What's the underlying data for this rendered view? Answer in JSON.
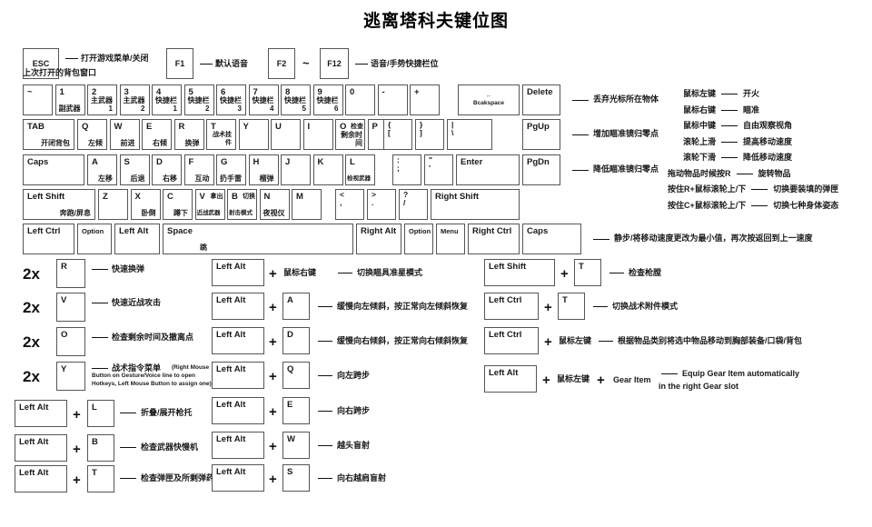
{
  "title": "逃离塔科夫键位图",
  "top_row": {
    "esc": {
      "label": "ESC",
      "desc_line1": "打开游戏菜单/关闭",
      "desc_line2": "上次打开的背包窗口"
    },
    "f1": {
      "label": "F1",
      "desc": "默认语音"
    },
    "f2": {
      "label": "F2"
    },
    "tilde_sep": "~",
    "f12": {
      "label": "F12",
      "desc": "语音/手势快捷栏位"
    }
  },
  "number_row": {
    "keys": [
      {
        "main": "~",
        "sub": ""
      },
      {
        "main": "1",
        "sub": "副武器"
      },
      {
        "main": "2",
        "sub": "主武器1"
      },
      {
        "main": "3",
        "sub": "主武器2"
      },
      {
        "main": "4",
        "sub": "快捷栏1"
      },
      {
        "main": "5",
        "sub": "快捷栏2"
      },
      {
        "main": "6",
        "sub": "快捷栏3"
      },
      {
        "main": "7",
        "sub": "快捷栏4"
      },
      {
        "main": "8",
        "sub": "快捷栏5"
      },
      {
        "main": "9",
        "sub": "快捷栏6"
      },
      {
        "main": "0",
        "sub": ""
      },
      {
        "main": "-",
        "sub": ""
      },
      {
        "main": "+",
        "sub": ""
      }
    ],
    "backspace": {
      "arrow": "←",
      "label": "Bcakspace"
    },
    "delete": {
      "label": "Delete",
      "desc": "丢弃光标所在物体"
    }
  },
  "qwerty_row": {
    "tab": {
      "main": "TAB",
      "sub": "开闭背包"
    },
    "keys": [
      {
        "main": "Q",
        "sub": "左倾"
      },
      {
        "main": "W",
        "sub": "前进"
      },
      {
        "main": "E",
        "sub": "右倾"
      },
      {
        "main": "R",
        "sub": "换弹"
      },
      {
        "main": "T",
        "sub": "战术挂件"
      },
      {
        "main": "Y",
        "sub": ""
      },
      {
        "main": "U",
        "sub": ""
      },
      {
        "main": "I",
        "sub": ""
      },
      {
        "main": "O",
        "sub": "检查",
        "sub2": "剩余时间"
      },
      {
        "main": "P",
        "sub": ""
      }
    ],
    "bracket_left": {
      "top": "{",
      "bottom": "["
    },
    "bracket_right": {
      "top": "}",
      "bottom": "]"
    },
    "backslash": {
      "top": "|",
      "bottom": "\\"
    },
    "pgup": {
      "label": "PgUp",
      "desc": "增加瞄准镜归零点"
    }
  },
  "asdf_row": {
    "caps": {
      "main": "Caps"
    },
    "keys": [
      {
        "main": "A",
        "sub": "左移"
      },
      {
        "main": "S",
        "sub": "后退"
      },
      {
        "main": "D",
        "sub": "右移"
      },
      {
        "main": "F",
        "sub": "互动"
      },
      {
        "main": "G",
        "sub": "扔手雷"
      },
      {
        "main": "H",
        "sub": "榴弹"
      },
      {
        "main": "J",
        "sub": ""
      },
      {
        "main": "K",
        "sub": ""
      },
      {
        "main": "L",
        "sub": "检视武器"
      }
    ],
    "semicolon": {
      "top": ":",
      "bottom": ";"
    },
    "quote": {
      "top": "\"",
      "bottom": "'"
    },
    "enter": {
      "main": "Enter"
    },
    "pgdn": {
      "label": "PgDn",
      "desc": "降低瞄准镜归零点"
    }
  },
  "zxcv_row": {
    "left_shift": {
      "main": "Left Shift",
      "sub": "奔跑/屏息"
    },
    "keys": [
      {
        "main": "Z",
        "sub": ""
      },
      {
        "main": "X",
        "sub": "卧倒"
      },
      {
        "main": "C",
        "sub": "蹲下"
      },
      {
        "main": "V",
        "side": "拿出",
        "sub": "近战武器"
      },
      {
        "main": "B",
        "side": "切换",
        "sub": "射击模式"
      },
      {
        "main": "N",
        "sub": "夜视仪"
      },
      {
        "main": "M",
        "sub": ""
      }
    ],
    "comma": {
      "top": "<",
      "bottom": ","
    },
    "period": {
      "top": ">",
      "bottom": "."
    },
    "slash": {
      "top": "?",
      "bottom": "/"
    },
    "right_shift": {
      "main": "Right Shift"
    }
  },
  "bottom_row": {
    "left_ctrl": {
      "main": "Left Ctrl"
    },
    "option_l": {
      "main": "Option"
    },
    "left_alt": {
      "main": "Left Alt"
    },
    "space": {
      "main": "Space",
      "sub": "跳"
    },
    "right_alt": {
      "main": "Right Alt"
    },
    "option_r": {
      "main": "Option"
    },
    "menu": {
      "main": "Menu"
    },
    "right_ctrl": {
      "main": "Right Ctrl"
    },
    "caps2": {
      "main": "Caps",
      "desc": "静步/将移动速度更改为最小值，再次按返回到上一速度"
    }
  },
  "mouse_list": [
    {
      "key": "鼠标左键",
      "desc": "开火"
    },
    {
      "key": "鼠标右键",
      "desc": "瞄准"
    },
    {
      "key": "鼠标中键",
      "desc": "自由观察视角"
    },
    {
      "key": "滚轮上滑",
      "desc": "提高移动速度"
    },
    {
      "key": "滚轮下滑",
      "desc": "降低移动速度"
    },
    {
      "key": "拖动物品时候按R",
      "desc": "旋转物品"
    },
    {
      "key": "按住R+鼠标滚轮上/下",
      "desc": "切换要装填的弹匣"
    },
    {
      "key": "按住C+鼠标滚轮上/下",
      "desc": "切换七种身体姿态"
    }
  ],
  "double_tap": {
    "prefix": "2x",
    "items": [
      {
        "key": "R",
        "desc": "快速换弹"
      },
      {
        "key": "V",
        "desc": "快速近战攻击"
      },
      {
        "key": "O",
        "desc": "检查剩余时间及撤离点"
      },
      {
        "key": "Y",
        "desc": "战术指令菜单",
        "en_line1": "(Right Mouse",
        "en_line2": "Button on Gesture/Voice line to open",
        "en_line3": "Hotkeys, Left Mouse Button to assign one)"
      }
    ]
  },
  "alt_left_combos": [
    {
      "mod": "Left Alt",
      "key": "L",
      "desc": "折叠/展开枪托"
    },
    {
      "mod": "Left Alt",
      "key": "B",
      "desc": "检查武器快慢机"
    },
    {
      "mod": "Left Alt",
      "key": "T",
      "desc": "检查弹匣及所剩弹药"
    }
  ],
  "alt_mid_combos": [
    {
      "mod": "Left Alt",
      "key": "鼠标右键",
      "key_is_text": true,
      "desc": "切换瞄具准星模式"
    },
    {
      "mod": "Left Alt",
      "key": "A",
      "desc": "缓慢向左倾斜，按正常向左倾斜恢复"
    },
    {
      "mod": "Left Alt",
      "key": "D",
      "desc": "缓慢向右倾斜，按正常向右倾斜恢复"
    },
    {
      "mod": "Left Alt",
      "key": "Q",
      "desc": "向左跨步"
    },
    {
      "mod": "Left Alt",
      "key": "E",
      "desc": "向右跨步"
    },
    {
      "mod": "Left Alt",
      "key": "W",
      "desc": "越头盲射"
    },
    {
      "mod": "Left Alt",
      "key": "S",
      "desc": "向右越肩盲射"
    }
  ],
  "right_combos": [
    {
      "mod": "Left Shift",
      "key": "T",
      "desc": "检查枪膛"
    },
    {
      "mod": "Left Ctrl",
      "key": "T",
      "desc": "切换战术附件模式"
    },
    {
      "mod": "Left Ctrl",
      "key": "鼠标左键",
      "key_is_text": true,
      "desc": "根据物品类别将选中物品移动到胸部装备/口袋/背包"
    }
  ],
  "gear_combo": {
    "mod": "Left Alt",
    "mid": "鼠标左键",
    "third": "Gear Item",
    "desc_line1": "Equip Gear Item automatically",
    "desc_line2": "in the right Gear slot"
  }
}
